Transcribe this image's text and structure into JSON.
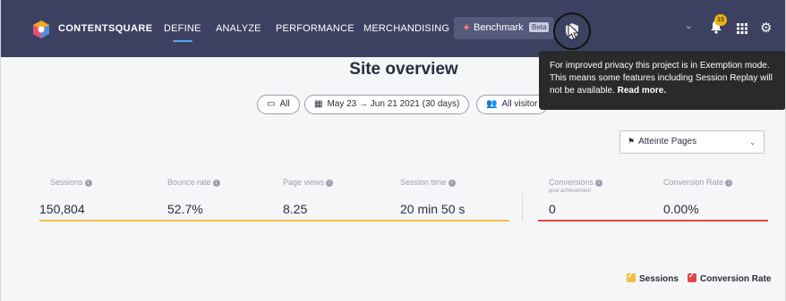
{
  "nav": {
    "brand": "CONTENTSQUARE",
    "items": [
      {
        "label": "DEFINE",
        "active": true
      },
      {
        "label": "ANALYZE",
        "active": false
      },
      {
        "label": "PERFORMANCE",
        "active": false
      },
      {
        "label": "MERCHANDISING",
        "active": false
      }
    ],
    "benchmark": {
      "label": "Benchmark",
      "badge": "Beta"
    },
    "notifications_count": "15",
    "icons": [
      "privacy-shield-icon",
      "chevron-down-icon",
      "bell-icon",
      "apps-grid-icon",
      "gear-icon"
    ]
  },
  "page": {
    "title": "Site overview"
  },
  "filters": {
    "device": "All",
    "date_range": "May 23 → Jun 21 2021 (30 days)",
    "visitors": "All visitor"
  },
  "tooltip": {
    "text": "For improved privacy this project is in Exemption mode. This means some features including Session Replay will not be available.",
    "link": "Read more."
  },
  "page_select": {
    "value": "Atteinte Pages"
  },
  "metrics": [
    {
      "label": "Sessions",
      "value": "150,804"
    },
    {
      "label": "Bounce rate",
      "value": "52.7%"
    },
    {
      "label": "Page views",
      "value": "8.25"
    },
    {
      "label": "Session time",
      "value": "20 min 50 s"
    },
    {
      "label": "Conversions",
      "sublabel": "goal achievement",
      "value": "0"
    },
    {
      "label": "Conversion Rate",
      "value": "0.00%"
    }
  ],
  "legend": [
    {
      "label": "Sessions",
      "color": "#f2be45"
    },
    {
      "label": "Conversion Rate",
      "color": "#e04747"
    }
  ],
  "colors": {
    "nav_bg": "#3d4161",
    "accent": "#4fa8ff",
    "sessions": "#f2be45",
    "conversion": "#e04747"
  }
}
